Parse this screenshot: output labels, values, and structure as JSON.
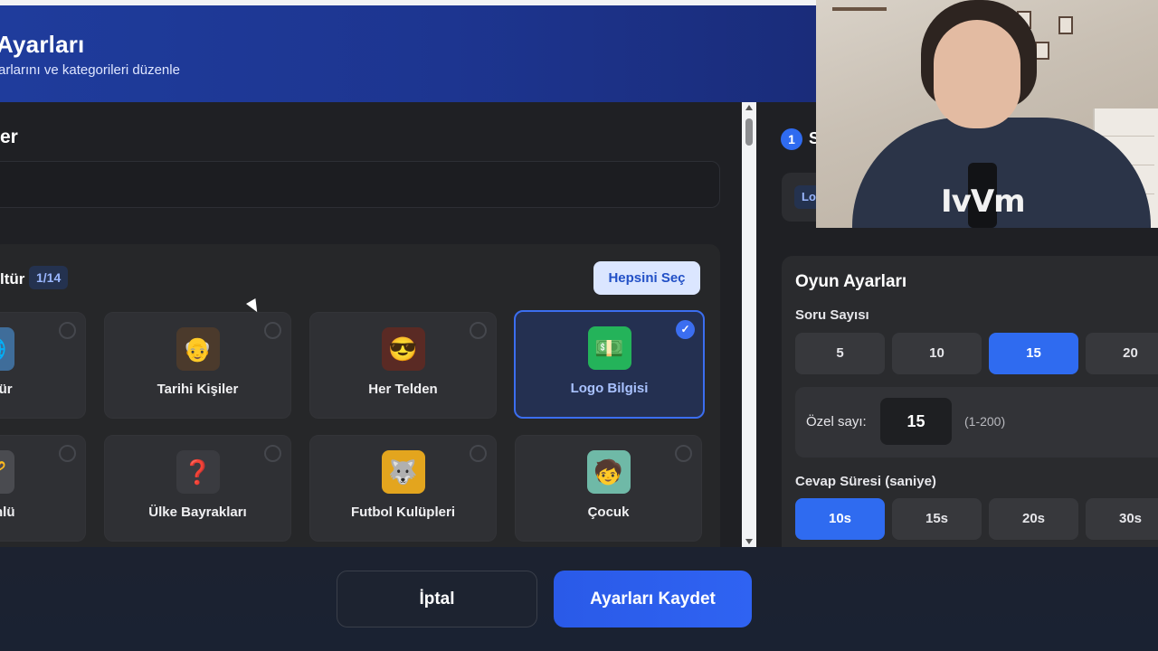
{
  "header": {
    "title": "Ayarları",
    "subtitle": "arlarını ve kategorileri düzenle"
  },
  "left": {
    "section_title": "er",
    "name_value": "",
    "category": {
      "title": "ltür",
      "count": "1/14",
      "select_all": "Hepsini Seç",
      "cards": [
        {
          "label": "Kültür",
          "icon": "globe-icon",
          "selected": false
        },
        {
          "label": "Tarihi Kişiler",
          "icon": "historic-portrait-icon",
          "selected": false
        },
        {
          "label": "Her Telden",
          "icon": "mixed-people-icon",
          "selected": false
        },
        {
          "label": "Logo Bilgisi",
          "icon": "logo-flag-icon",
          "selected": true
        },
        {
          "label": "ki Ünlü",
          "icon": "celebrity-icon",
          "selected": false
        },
        {
          "label": "Ülke Bayrakları",
          "icon": "flag-question-icon",
          "selected": false
        },
        {
          "label": "Futbol Kulüpleri",
          "icon": "wolf-crest-icon",
          "selected": false
        },
        {
          "label": "Çocuk",
          "icon": "child-icon",
          "selected": false
        }
      ]
    }
  },
  "right": {
    "step_number": "1",
    "step_title": "S",
    "step_chip": "Lo",
    "game_settings": {
      "title": "Oyun Ayarları",
      "question_count_label": "Soru Sayısı",
      "question_options": [
        "5",
        "10",
        "15",
        "20"
      ],
      "question_selected": "15",
      "custom_label": "Özel sayı:",
      "custom_value": "15",
      "custom_range": "(1-200)",
      "answer_time_label": "Cevap Süresi (saniye)",
      "time_options": [
        "10s",
        "15s",
        "20s",
        "30s"
      ],
      "time_selected": "10s"
    }
  },
  "footer": {
    "cancel_label": "İptal",
    "save_label": "Ayarları Kaydet"
  },
  "webcam": {
    "logo_text": "IvVm"
  },
  "colors": {
    "accent": "#2f6bf0",
    "header_bg": "#1f3c9c",
    "panel_bg": "#1f2024"
  }
}
